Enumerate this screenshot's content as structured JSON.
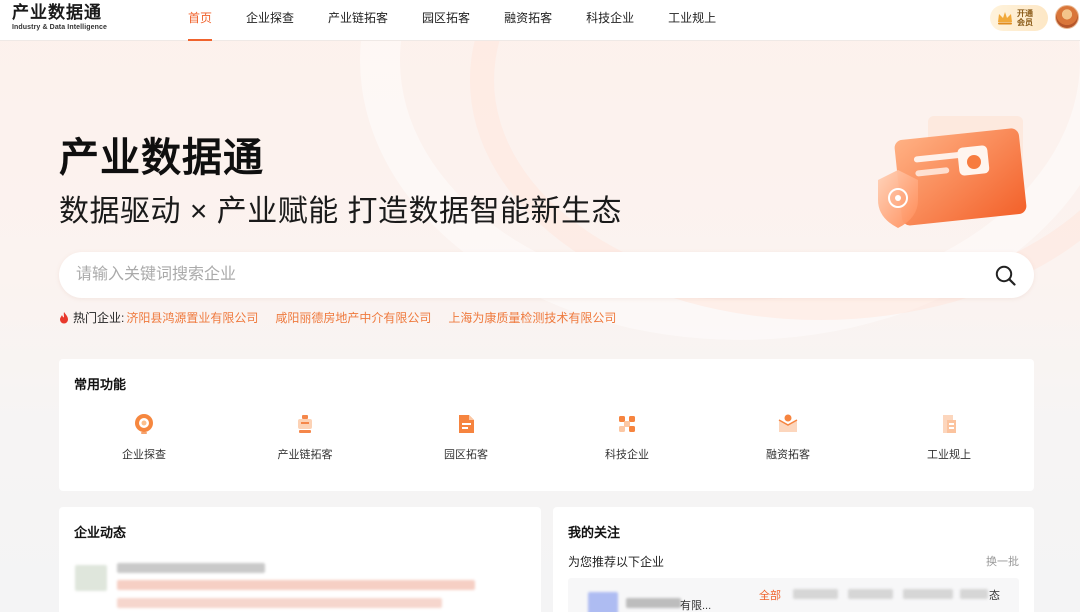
{
  "header": {
    "logo_main": "产业数据通",
    "logo_sub": "Industry & Data Intelligence",
    "nav": [
      {
        "label": "首页",
        "active": true
      },
      {
        "label": "企业探查",
        "active": false
      },
      {
        "label": "产业链拓客",
        "active": false
      },
      {
        "label": "园区拓客",
        "active": false
      },
      {
        "label": "融资拓客",
        "active": false
      },
      {
        "label": "科技企业",
        "active": false
      },
      {
        "label": "工业规上",
        "active": false
      }
    ],
    "vip_label": "开通会员"
  },
  "hero": {
    "title": "产业数据通",
    "subtitle": "数据驱动 × 产业赋能 打造数据智能新生态"
  },
  "search": {
    "placeholder": "请输入关键词搜索企业",
    "value": ""
  },
  "hot": {
    "label": "热门企业:",
    "companies": [
      "济阳县鸿源置业有限公司",
      "咸阳丽德房地产中介有限公司",
      "上海为康质量检测技术有限公司"
    ]
  },
  "functions": {
    "title": "常用功能",
    "items": [
      {
        "label": "企业探查",
        "icon": "enterprise-search-icon"
      },
      {
        "label": "产业链拓客",
        "icon": "industry-chain-icon"
      },
      {
        "label": "园区拓客",
        "icon": "park-icon"
      },
      {
        "label": "科技企业",
        "icon": "tech-enterprise-icon"
      },
      {
        "label": "融资拓客",
        "icon": "financing-icon"
      },
      {
        "label": "工业规上",
        "icon": "industrial-scale-icon"
      }
    ]
  },
  "news": {
    "title": "企业动态"
  },
  "follow": {
    "title": "我的关注",
    "recommend": "为您推荐以下企业",
    "swap": "换一批",
    "tab_all": "全部",
    "partial_company": "有限...",
    "partial_tab": "态"
  },
  "colors": {
    "accent": "#f0632d",
    "hot_link": "#ef7a3e"
  }
}
